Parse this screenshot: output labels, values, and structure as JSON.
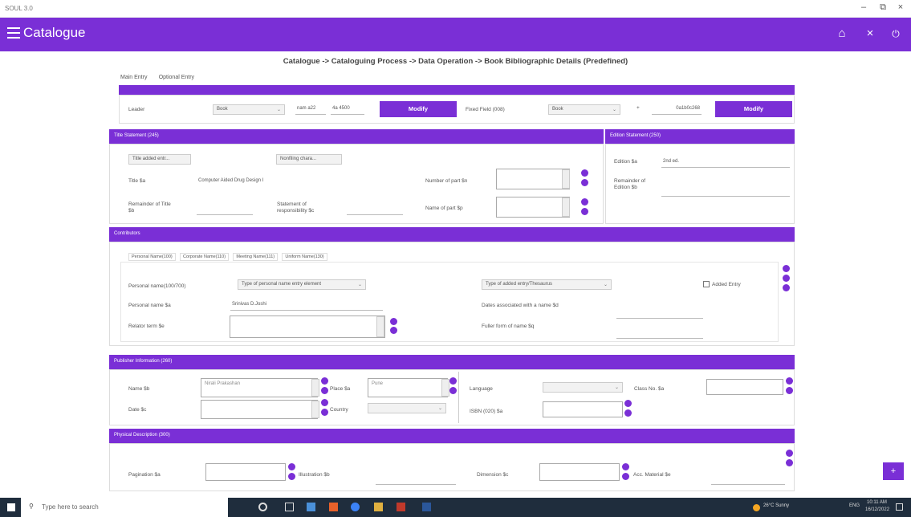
{
  "window": {
    "title": "SOUL 3.0",
    "minimize": "–",
    "maximize": "⧉",
    "close": "×"
  },
  "appbar": {
    "title": "Catalogue",
    "home_icon": "⌂",
    "close_icon": "×",
    "power_icon": "⏻",
    "bg": "#7a2fd6"
  },
  "breadcrumb": "Catalogue -> Cataloguing Process -> Data Operation -> Book Bibliographic Details (Predefined)",
  "tabs": [
    "Main Entry",
    "Optional Entry"
  ],
  "leader": {
    "label": "Leader",
    "type": "Book",
    "code1": "nam a22",
    "code2": "4a 4500",
    "modify": "Modify"
  },
  "fixed": {
    "label": "Fixed Field (008)",
    "type": "Book",
    "code": "0a1b0c268",
    "modify": "Modify"
  },
  "title_statement": {
    "header": "Title Statement (245)",
    "added_entry": "Title added entr...",
    "nonfiling": "Nonfiling chara...",
    "title_label": "Title $a",
    "title_value": "Computer Aided Drug Design I",
    "remainder_label": "Remainder of Title $b",
    "responsibility_label": "Statement of responsibility $c",
    "part_number_label": "Number of part $n",
    "part_name_label": "Name of part $p"
  },
  "edition": {
    "header": "Edition Statement (250)",
    "edition_label": "Edition $a",
    "edition_value": "2nd ed.",
    "remainder_label": "Remainder of Edition $b"
  },
  "contributors": {
    "header": "Contributors",
    "tabs": [
      "Personal Name(100)",
      "Corporate Name(110)",
      "Meeting Name(111)",
      "Uniform Name(130)"
    ],
    "personal_label": "Personal name(100/700)",
    "type_personal": "Type of personal name entry element",
    "type_added": "Type of added entry/Thesaurus",
    "added_entry": "Added Entry",
    "name_label": "Personal name $a",
    "name_value": "Srinivas D.Joshi",
    "dates_label": "Dates associated with a name $d",
    "relator_label": "Relator term $e",
    "fuller_label": "Fuller form of name $q"
  },
  "publisher": {
    "header": "Publisher Information (260)",
    "name_label": "Name $b",
    "name_value": "Nirali Prakashan",
    "place_label": "Place $a",
    "place_value": "Pune",
    "date_label": "Date $c",
    "country_label": "Country",
    "language_label": "Language",
    "isbn_label": "ISBN (020) $a",
    "class_label": "Class No. $a"
  },
  "physical": {
    "header": "Physical Description (300)",
    "pagination_label": "Pagination $a",
    "illustration_label": "Illustration $b",
    "dimension_label": "Dimension $c",
    "acc_label": "Acc. Material $e"
  },
  "fab": "+",
  "taskbar": {
    "search": "Type here to search",
    "weather": "26°C Sunny",
    "lang": "ENG",
    "time": "10:11 AM",
    "date": "16/12/2022"
  }
}
